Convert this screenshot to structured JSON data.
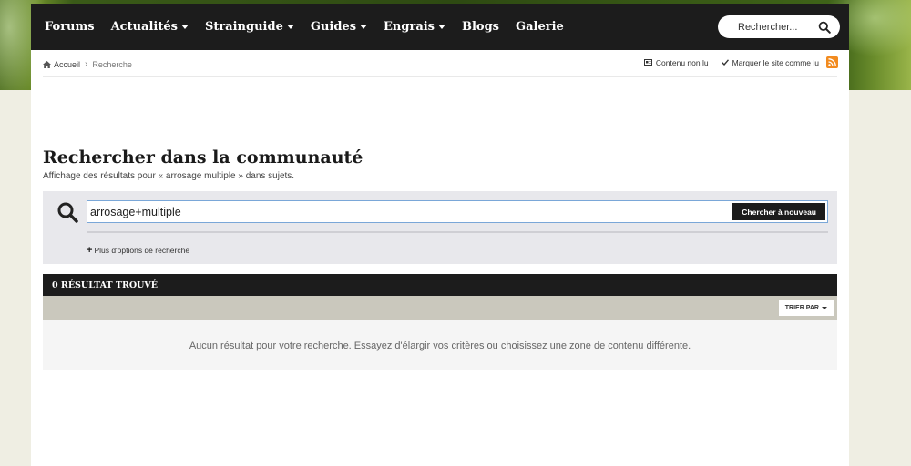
{
  "nav": {
    "items": [
      {
        "label": "Forums",
        "dropdown": false
      },
      {
        "label": "Actualités",
        "dropdown": true
      },
      {
        "label": "Strainguide",
        "dropdown": true
      },
      {
        "label": "Guides",
        "dropdown": true
      },
      {
        "label": "Engrais",
        "dropdown": true
      },
      {
        "label": "Blogs",
        "dropdown": false
      },
      {
        "label": "Galerie",
        "dropdown": false
      }
    ],
    "search_placeholder": "Rechercher..."
  },
  "breadcrumb": {
    "home": "Accueil",
    "current": "Recherche"
  },
  "actions": {
    "unread": "Contenu non lu",
    "mark_read": "Marquer le site comme lu"
  },
  "header": {
    "title": "Rechercher dans la communauté",
    "subtitle": "Affichage des résultats pour « arrosage multiple » dans sujets."
  },
  "search": {
    "value": "arrosage+multiple",
    "button": "Chercher à nouveau",
    "more_options": "Plus d'options de recherche"
  },
  "results": {
    "count_label": "0 RÉSULTAT TROUVÉ",
    "sort_label": "TRIER PAR",
    "empty_message": "Aucun résultat pour votre recherche. Essayez d'élargir vos critères ou choisissez une zone de contenu différente."
  },
  "colors": {
    "nav_bg": "#1c1c1c",
    "rss": "#f28b1f",
    "page_bg": "#efeee3"
  }
}
